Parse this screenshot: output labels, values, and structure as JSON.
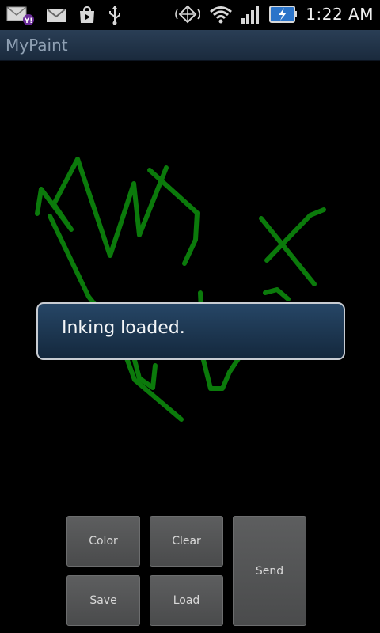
{
  "status_bar": {
    "time": "1:22 AM",
    "icons": [
      "yahoo-mail-icon",
      "gmail-icon",
      "play-store-icon",
      "usb-icon",
      "gps-icon",
      "wifi-icon",
      "signal-icon",
      "battery-charging-icon"
    ]
  },
  "app": {
    "title": "MyPaint"
  },
  "toast": {
    "message": "Inking loaded."
  },
  "buttons": {
    "color": "Color",
    "clear": "Clear",
    "save": "Save",
    "load": "Load",
    "send": "Send"
  },
  "colors": {
    "ink": "#0b7a0b",
    "title_bar": "#1f3247",
    "toast_bg": "#1e3a57",
    "button_bg": "#555657"
  }
}
